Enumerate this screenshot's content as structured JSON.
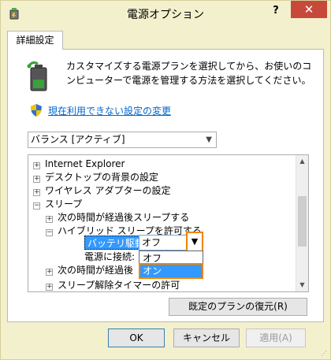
{
  "window": {
    "title": "電源オプション",
    "help_label": "?",
    "close_label": "✕",
    "icon": "power-options-icon"
  },
  "tab": {
    "label": "詳細設定"
  },
  "intro": {
    "icon": "battery-icon",
    "description": "カスタマイズする電源プランを選択してから、お使いのコンピューターで電源を管理する方法を選択してください。"
  },
  "change_link": {
    "icon": "shield-icon",
    "label": "現在利用できない設定の変更"
  },
  "plan_select": {
    "value": "バランス [アクティブ]"
  },
  "tree": {
    "items": [
      {
        "expander": "+",
        "label": "Internet Explorer"
      },
      {
        "expander": "+",
        "label": "デスクトップの背景の設定"
      },
      {
        "expander": "+",
        "label": "ワイヤレス アダプターの設定"
      },
      {
        "expander": "−",
        "label": "スリープ"
      },
      {
        "expander": "+",
        "label": "次の時間が経過後スリープする"
      },
      {
        "expander": "−",
        "label": "ハイブリッド スリープを許可する"
      },
      {
        "expander": "",
        "label": "電源に接続:"
      },
      {
        "expander": "+",
        "label": "次の時間が経過後"
      },
      {
        "expander": "+",
        "label": "スリープ解除タイマーの許可"
      }
    ],
    "battery_setting": {
      "label": "バッテリ駆動:",
      "value": "オフ"
    },
    "dropdown_options": [
      "オフ",
      "オン"
    ],
    "dropdown_highlighted": "オン"
  },
  "buttons": {
    "restore": "既定のプランの復元(R)",
    "ok": "OK",
    "cancel": "キャンセル",
    "apply": "適用(A)"
  },
  "colors": {
    "window_bg": "#f3f0cd",
    "close_button": "#c7493a",
    "selection": "#3399ff",
    "highlight_frame": "#f08300",
    "link": "#0066cc"
  }
}
